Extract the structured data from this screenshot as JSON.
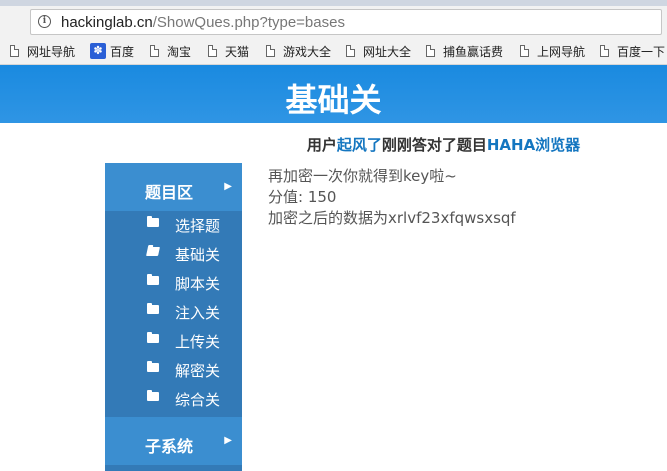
{
  "browser": {
    "url_host": "hackinglab.cn",
    "url_rest": "/ShowQues.php?type=bases",
    "bookmarks": [
      "网址导航",
      "百度",
      "淘宝",
      "天猫",
      "游戏大全",
      "网址大全",
      "捕鱼赢话费",
      "上网导航",
      "百度一下"
    ]
  },
  "page": {
    "title": "基础关",
    "notice": {
      "prefix": "用户",
      "user": "起风了",
      "middle": "刚刚答对了题目",
      "problem": "HAHA浏览器"
    },
    "sidebar": {
      "section1": "题目区",
      "items": [
        "选择题",
        "基础关",
        "脚本关",
        "注入关",
        "上传关",
        "解密关",
        "综合关"
      ],
      "section2": "子系统"
    },
    "content": {
      "line1": "再加密一次你就得到key啦~",
      "line2": "分值: 150",
      "line3": "加密之后的数据为xrlvf23xfqwsxsqf"
    }
  }
}
